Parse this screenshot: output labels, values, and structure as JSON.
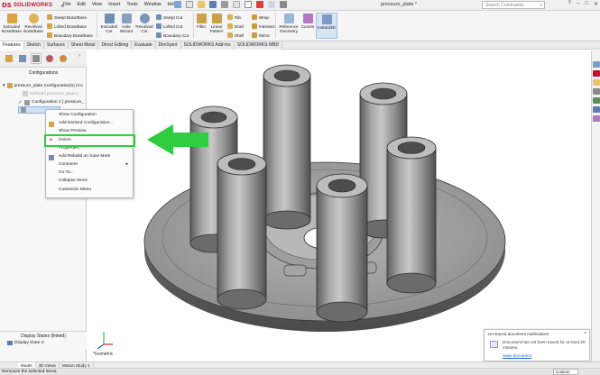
{
  "app": {
    "brand": "SOLIDWORKS",
    "brand_mark": "DS",
    "document_title": "pressure_plate *",
    "search_placeholder": "Search Commands"
  },
  "menu": [
    "File",
    "Edit",
    "View",
    "Insert",
    "Tools",
    "Window",
    "Help"
  ],
  "window_controls": [
    "?",
    "–",
    "□",
    "✕"
  ],
  "ribbon": {
    "extruded_boss": "Extruded Boss/Base",
    "revolved_boss": "Revolved Boss/Base",
    "swept_boss": "Swept Boss/Base",
    "lofted_boss": "Lofted Boss/Base",
    "boundary_boss": "Boundary Boss/Base",
    "extruded_cut": "Extruded Cut",
    "hole_wizard": "Hole Wizard",
    "revolved_cut": "Revolved Cut",
    "swept_cut": "Swept Cut",
    "lofted_cut": "Lofted Cut",
    "boundary_cut": "Boundary Cut",
    "fillet": "Fillet",
    "linear_pattern": "Linear Pattern",
    "rib": "Rib",
    "draft": "Draft",
    "shell": "Shell",
    "wrap": "Wrap",
    "intersect": "Intersect",
    "mirror": "Mirror",
    "reference_geometry": "Reference Geometry",
    "curves": "Curves",
    "instant3d": "Instant3D"
  },
  "command_tabs": [
    "Features",
    "Sketch",
    "Surfaces",
    "Sheet Metal",
    "Direct Editing",
    "Evaluate",
    "DimXpert",
    "SOLIDWORKS Add-Ins",
    "SOLIDWORKS MBD"
  ],
  "left_panel": {
    "header": "Configurations",
    "tree": [
      {
        "label": "pressure_plate Configuration(s)  (Co"
      },
      {
        "label": "Default [ pressure_plate ]"
      },
      {
        "label": "Configuration 1 [ pressure_"
      },
      {
        "label": "Configuration 1"
      }
    ],
    "display_states_title": "Display States (linked)",
    "display_state_item": "Display State-3"
  },
  "context_menu": {
    "items": [
      {
        "label": "Show Configuration"
      },
      {
        "label": "Add Derived Configuration..."
      },
      {
        "label": "Show Preview"
      },
      {
        "label": "Delete"
      },
      {
        "label": "Properties..."
      },
      {
        "label": "Add Rebuild on Save Mark"
      },
      {
        "label": "Comment"
      },
      {
        "label": "Go To..."
      },
      {
        "label": "Collapse Items"
      },
      {
        "label": "Customize Menu"
      }
    ]
  },
  "viewport": {
    "view_label": "*Isometric"
  },
  "bottom_tabs": [
    "Model",
    "3D Views",
    "Motion Study 1"
  ],
  "status": {
    "message": "Removes the selected items.",
    "custom": "Custom"
  },
  "notification": {
    "title": "Un-Saved document notifications",
    "body": "Document has not been saved for at least 20 minutes.",
    "link": "Save document"
  },
  "colors": {
    "accent_red": "#c8102e",
    "highlight_green": "#2ecc40",
    "part_gray": "#8c8c8c"
  }
}
